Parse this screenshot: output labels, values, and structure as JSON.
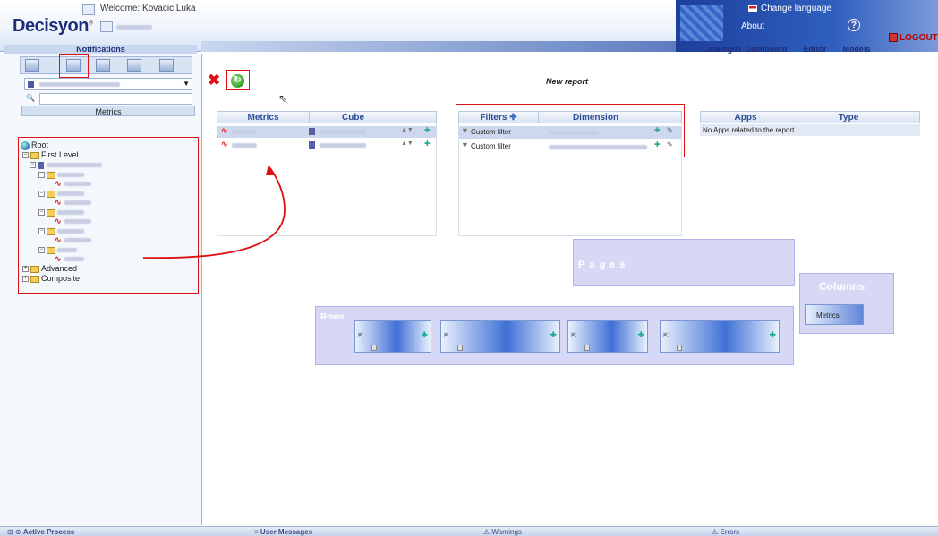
{
  "header": {
    "logo": "Decisyon",
    "welcome": "Welcome: Kovacic Luka",
    "change_language": "Change language",
    "about": "About",
    "logout": "LOGOUT",
    "nav": [
      "Catalogue",
      "Dashboard",
      "Editor",
      "Models"
    ]
  },
  "left_panel": {
    "notifications": "Notifications",
    "metrics_label": "Metrics",
    "tree": {
      "root": "Root",
      "first_level": "First Level",
      "advanced": "Advanced",
      "composite": "Composite"
    }
  },
  "main": {
    "title": "New report",
    "metrics_table": {
      "headers": [
        "Metrics",
        "Cube"
      ]
    },
    "filters_table": {
      "headers": [
        "Filters",
        "Dimension"
      ],
      "rows": [
        "Custom filter",
        "Custom filter"
      ]
    },
    "apps_table": {
      "headers": [
        "Apps",
        "Type"
      ],
      "empty_message": "No Apps related to the report."
    },
    "zones": {
      "pages": "Pages",
      "columns": "Columns",
      "columns_chip": "Metrics",
      "rows": "Rows"
    }
  },
  "status_bar": {
    "items": [
      "Active Process",
      "User Messages",
      "Warnings",
      "Errors"
    ]
  },
  "colors": {
    "accent": "#1e2d78",
    "highlight": "#dd1111"
  }
}
